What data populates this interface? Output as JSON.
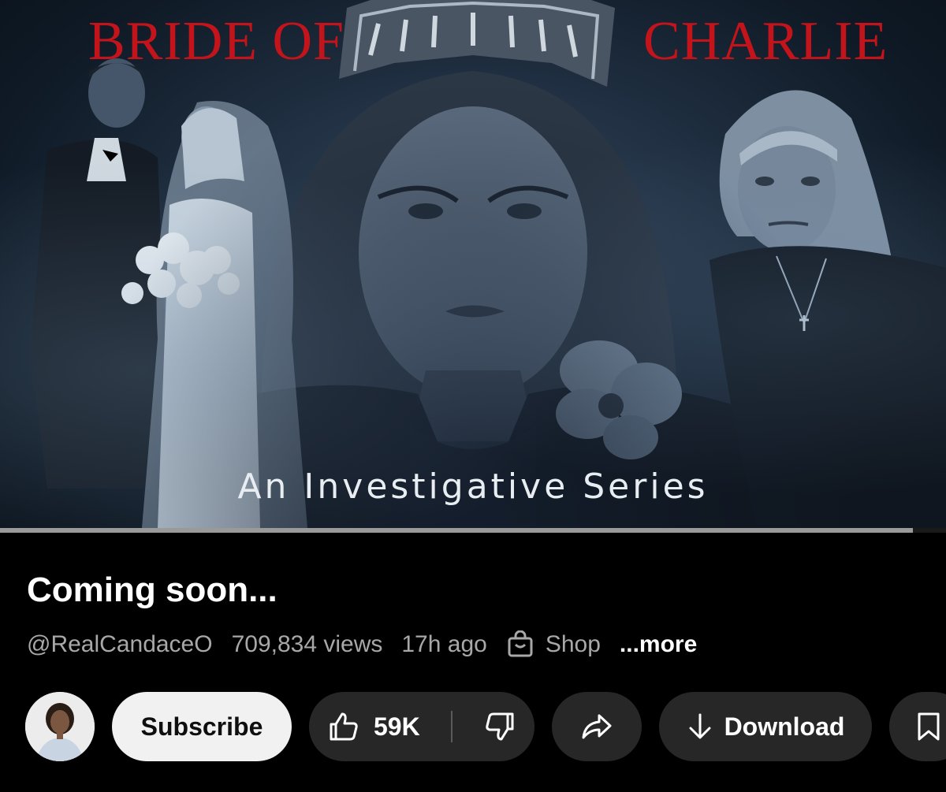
{
  "thumbnail": {
    "title_left": "BRIDE OF",
    "title_right": "CHARLIE",
    "subtitle": "An Investigative Series",
    "title_color": "#c3141c"
  },
  "player": {
    "progress": 0.965
  },
  "video": {
    "title": "Coming soon...",
    "channel": "@RealCandaceO",
    "views": "709,834 views",
    "posted": "17h ago",
    "shop_label": "Shop",
    "more_label": "...more"
  },
  "actions": {
    "subscribe_label": "Subscribe",
    "like_count": "59K",
    "download_label": "Download"
  },
  "icons": {
    "shop": "shopping-bag-icon",
    "like": "thumbs-up-icon",
    "dislike": "thumbs-down-icon",
    "share": "share-arrow-icon",
    "download": "download-arrow-icon",
    "save": "bookmark-icon"
  }
}
